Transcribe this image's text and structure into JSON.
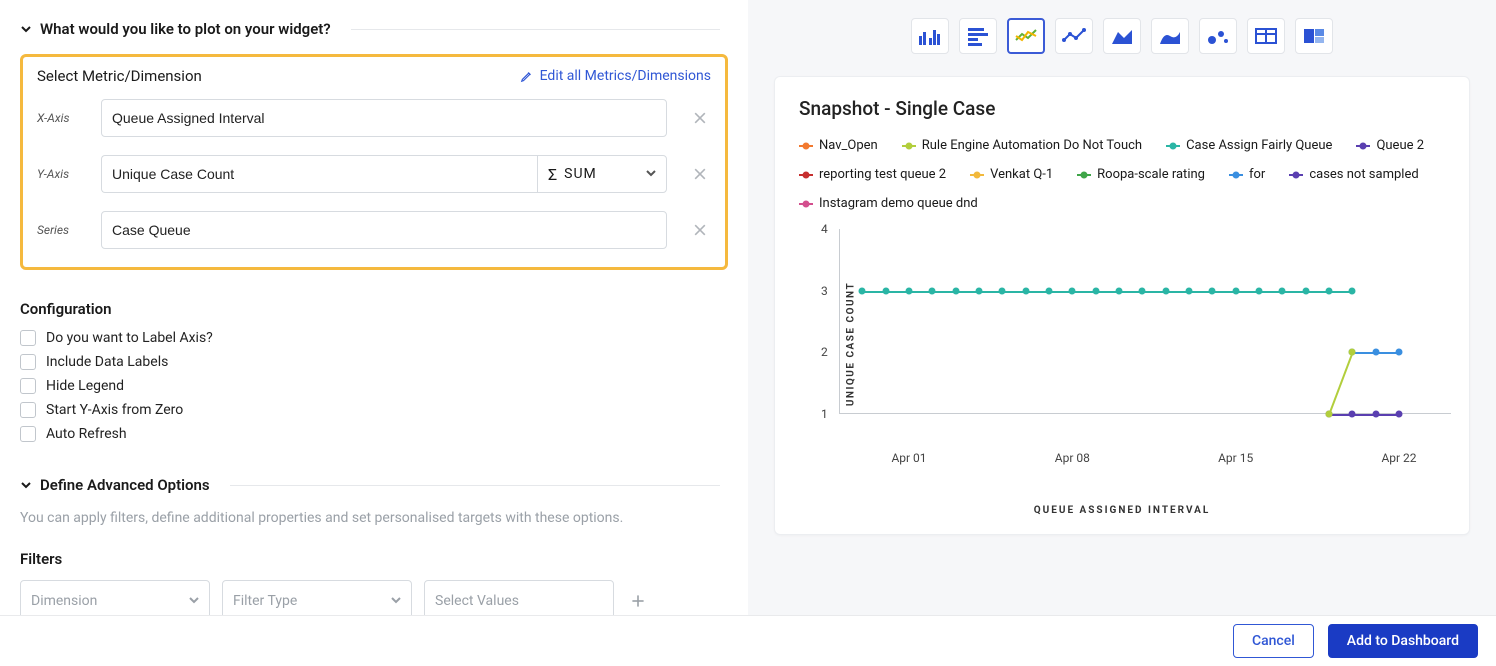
{
  "section_plot": {
    "title": "What would you like to plot on your widget?",
    "metric_label": "Select Metric/Dimension",
    "edit_link": "Edit all Metrics/Dimensions",
    "x_label": "X-Axis",
    "x_value": "Queue Assigned Interval",
    "y_label": "Y-Axis",
    "y_value": "Unique Case Count",
    "y_agg": "SUM",
    "series_label": "Series",
    "series_value": "Case Queue"
  },
  "configuration": {
    "title": "Configuration",
    "options": [
      "Do you want to Label Axis?",
      "Include Data Labels",
      "Hide Legend",
      "Start Y-Axis from Zero",
      "Auto Refresh"
    ]
  },
  "advanced": {
    "title": "Define Advanced Options",
    "desc": "You can apply filters, define additional properties and set personalised targets with these options.",
    "filters_title": "Filters",
    "dim_placeholder": "Dimension",
    "ftype_placeholder": "Filter Type",
    "values_placeholder": "Select Values"
  },
  "preview": {
    "title": "Snapshot - Single Case",
    "legend": [
      {
        "name": "Nav_Open",
        "color": "#f2792f"
      },
      {
        "name": "Rule Engine Automation Do Not Touch",
        "color": "#b2ce3c"
      },
      {
        "name": "Case Assign Fairly Queue",
        "color": "#2ab5a5"
      },
      {
        "name": "Queue 2",
        "color": "#5a3fb0"
      },
      {
        "name": "reporting test queue 2",
        "color": "#c62f2f"
      },
      {
        "name": "Venkat Q-1",
        "color": "#f2b93c"
      },
      {
        "name": "Roopa-scale rating",
        "color": "#3fa548"
      },
      {
        "name": "for",
        "color": "#3a8fe0"
      },
      {
        "name": "cases not sampled",
        "color": "#5a3fb0"
      },
      {
        "name": "Instagram demo queue dnd",
        "color": "#d34f8e"
      }
    ],
    "y_title": "UNIQUE CASE COUNT",
    "y_ticks": [
      "1",
      "2",
      "3",
      "4"
    ],
    "x_title": "QUEUE ASSIGNED INTERVAL",
    "x_ticks": [
      "Apr 01",
      "Apr 08",
      "Apr 15",
      "Apr 22"
    ]
  },
  "footer": {
    "cancel": "Cancel",
    "add": "Add to Dashboard"
  },
  "chart_data": {
    "type": "line",
    "title": "Snapshot - Single Case",
    "xlabel": "QUEUE ASSIGNED INTERVAL",
    "ylabel": "UNIQUE CASE COUNT",
    "ylim": [
      1,
      4
    ],
    "x_range": [
      "Apr 01",
      "Apr 22"
    ],
    "series": [
      {
        "name": "Case Assign Fairly Queue",
        "color": "#2ab5a5",
        "points": [
          {
            "x": "Mar 30",
            "y": 3
          },
          {
            "x": "Mar 31",
            "y": 3
          },
          {
            "x": "Apr 01",
            "y": 3
          },
          {
            "x": "Apr 02",
            "y": 3
          },
          {
            "x": "Apr 03",
            "y": 3
          },
          {
            "x": "Apr 04",
            "y": 3
          },
          {
            "x": "Apr 05",
            "y": 3
          },
          {
            "x": "Apr 06",
            "y": 3
          },
          {
            "x": "Apr 07",
            "y": 3
          },
          {
            "x": "Apr 08",
            "y": 3
          },
          {
            "x": "Apr 09",
            "y": 3
          },
          {
            "x": "Apr 10",
            "y": 3
          },
          {
            "x": "Apr 11",
            "y": 3
          },
          {
            "x": "Apr 12",
            "y": 3
          },
          {
            "x": "Apr 13",
            "y": 3
          },
          {
            "x": "Apr 14",
            "y": 3
          },
          {
            "x": "Apr 15",
            "y": 3
          },
          {
            "x": "Apr 16",
            "y": 3
          },
          {
            "x": "Apr 17",
            "y": 3
          },
          {
            "x": "Apr 18",
            "y": 3
          },
          {
            "x": "Apr 19",
            "y": 3
          },
          {
            "x": "Apr 20",
            "y": 3
          }
        ]
      },
      {
        "name": "for",
        "color": "#3a8fe0",
        "points": [
          {
            "x": "Apr 20",
            "y": 2
          },
          {
            "x": "Apr 21",
            "y": 2
          },
          {
            "x": "Apr 22",
            "y": 2
          }
        ]
      },
      {
        "name": "Queue 2",
        "color": "#5a3fb0",
        "points": [
          {
            "x": "Apr 19",
            "y": 1
          },
          {
            "x": "Apr 20",
            "y": 1
          },
          {
            "x": "Apr 21",
            "y": 1
          },
          {
            "x": "Apr 22",
            "y": 1
          }
        ]
      },
      {
        "name": "Rule Engine Automation Do Not Touch",
        "color": "#b2ce3c",
        "points": [
          {
            "x": "Apr 19",
            "y": 1
          },
          {
            "x": "Apr 20",
            "y": 2
          }
        ]
      }
    ]
  }
}
